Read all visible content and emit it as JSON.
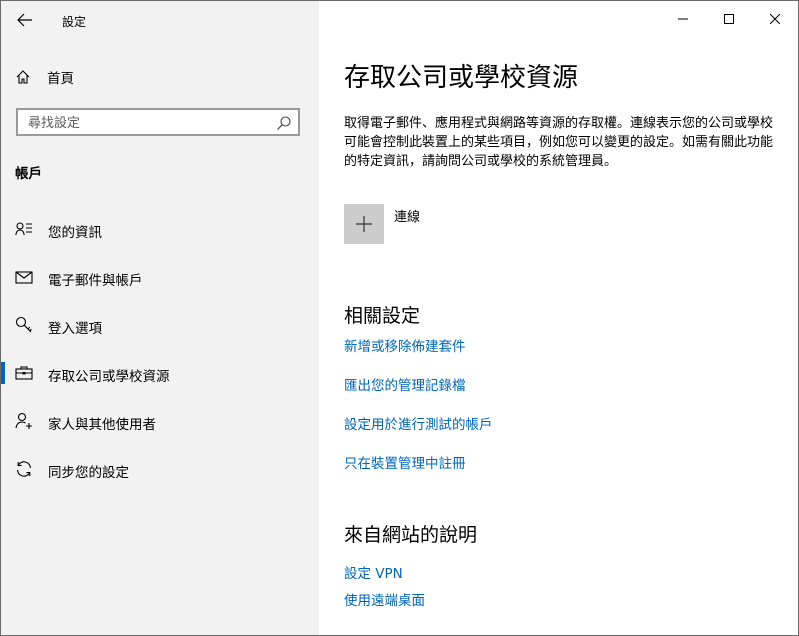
{
  "window": {
    "title": "設定"
  },
  "sidebar": {
    "home_label": "首頁",
    "search_placeholder": "尋找設定",
    "section_header": "帳戶",
    "items": [
      {
        "label": "您的資訊",
        "icon": "user-info-icon",
        "selected": false
      },
      {
        "label": "電子郵件與帳戶",
        "icon": "mail-icon",
        "selected": false
      },
      {
        "label": "登入選項",
        "icon": "key-icon",
        "selected": false
      },
      {
        "label": "存取公司或學校資源",
        "icon": "briefcase-icon",
        "selected": true
      },
      {
        "label": "家人與其他使用者",
        "icon": "add-person-icon",
        "selected": false
      },
      {
        "label": "同步您的設定",
        "icon": "sync-icon",
        "selected": false
      }
    ]
  },
  "main": {
    "title": "存取公司或學校資源",
    "description": "取得電子郵件、應用程式與網路等資源的存取權。連線表示您的公司或學校可能會控制此裝置上的某些項目，例如您可以變更的設定。如需有關此功能的特定資訊，請詢問公司或學校的系統管理員。",
    "connect_label": "連線",
    "related_settings": {
      "title": "相關設定",
      "links": [
        "新增或移除佈建套件",
        "匯出您的管理記錄檔",
        "設定用於進行測試的帳戶",
        "只在裝置管理中註冊"
      ]
    },
    "web_help": {
      "title": "來自網站的說明",
      "links": [
        "設定 VPN",
        "使用遠端桌面"
      ]
    }
  },
  "colors": {
    "accent": "#0067c0",
    "link": "#0066b4",
    "sidebar_bg": "#f2f2f2",
    "connect_button_bg": "#cccccc"
  }
}
